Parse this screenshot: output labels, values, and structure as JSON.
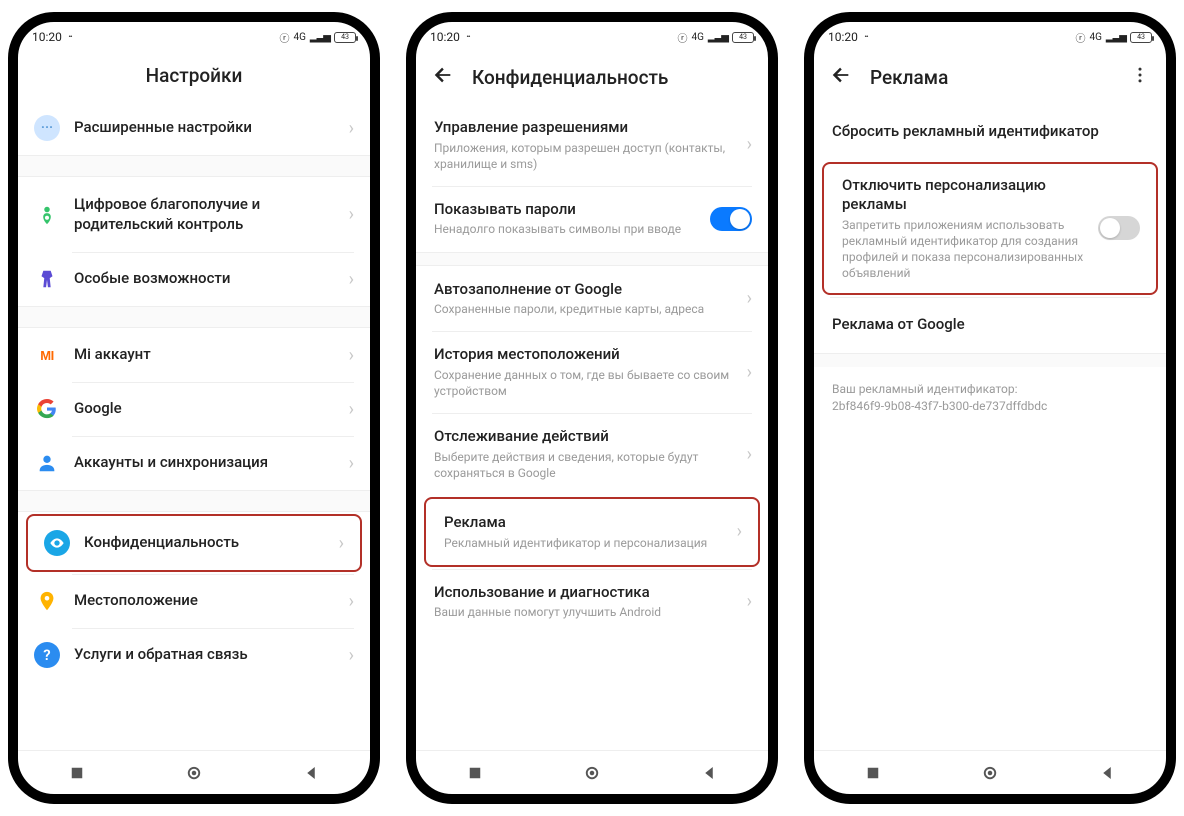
{
  "status": {
    "time": "10:20",
    "net": "4G",
    "batt": "43"
  },
  "phone1": {
    "title": "Настройки",
    "items": {
      "advanced": "Расширенные настройки",
      "wellbeing": "Цифровое благополучие и родительский контроль",
      "accessibility": "Особые возможности",
      "mi_account": "Mi аккаунт",
      "google": "Google",
      "accounts_sync": "Аккаунты и синхронизация",
      "privacy": "Конфиденциальность",
      "location": "Местоположение",
      "support": "Услуги и обратная связь"
    }
  },
  "phone2": {
    "title": "Конфиденциальность",
    "perm": {
      "t": "Управление разрешениями",
      "s": "Приложения, которым разрешен доступ (контакты, хранилище и sms)"
    },
    "pwd": {
      "t": "Показывать пароли",
      "s": "Ненадолго показывать символы при вводе"
    },
    "autofill": {
      "t": "Автозаполнение от Google",
      "s": "Сохраненные пароли, кредитные карты, адреса"
    },
    "lochist": {
      "t": "История местоположений",
      "s": "Сохранение данных о том, где вы бываете со своим устройством"
    },
    "activity": {
      "t": "Отслеживание действий",
      "s": "Выберите действия и сведения, которые будут сохраняться в Google"
    },
    "ads": {
      "t": "Реклама",
      "s": "Рекламный идентификатор и персонализация"
    },
    "diag": {
      "t": "Использование и диагностика",
      "s": "Ваши данные помогут улучшить Android"
    }
  },
  "phone3": {
    "title": "Реклама",
    "reset": "Сбросить рекламный идентификатор",
    "opt": {
      "t": "Отключить персонализацию рекламы",
      "s": "Запретить приложениям использовать рекламный идентификатор для создания профилей и показа персонализированных объявлений"
    },
    "google_ads": "Реклама от Google",
    "id_label": "Ваш рекламный идентификатор:",
    "id_value": "2bf846f9-9b08-43f7-b300-de737dffdbdc"
  }
}
